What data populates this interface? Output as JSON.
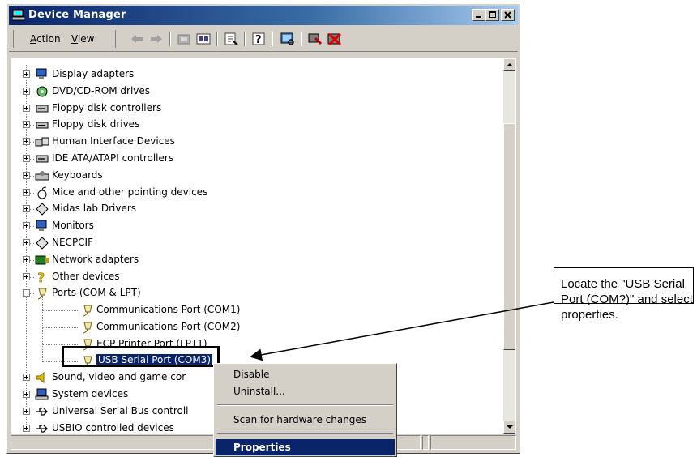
{
  "window": {
    "title": "Device Manager",
    "menu": [
      {
        "label_acc": "A",
        "label_rest": "ction"
      },
      {
        "label_acc": "V",
        "label_rest": "iew"
      }
    ]
  },
  "tree": {
    "items": [
      {
        "label": "Display adapters",
        "icon": "display-icon",
        "state": "collapsed"
      },
      {
        "label": "DVD/CD-ROM drives",
        "icon": "dvd-icon",
        "state": "collapsed"
      },
      {
        "label": "Floppy disk controllers",
        "icon": "disk-controller-icon",
        "state": "collapsed"
      },
      {
        "label": "Floppy disk drives",
        "icon": "floppy-drive-icon",
        "state": "collapsed"
      },
      {
        "label": "Human Interface Devices",
        "icon": "hid-icon",
        "state": "collapsed"
      },
      {
        "label": "IDE ATA/ATAPI controllers",
        "icon": "ide-icon",
        "state": "collapsed"
      },
      {
        "label": "Keyboards",
        "icon": "keyboard-icon",
        "state": "collapsed"
      },
      {
        "label": "Mice and other pointing devices",
        "icon": "mouse-icon",
        "state": "collapsed"
      },
      {
        "label": "Midas lab Drivers",
        "icon": "device-icon",
        "state": "collapsed"
      },
      {
        "label": "Monitors",
        "icon": "monitor-icon",
        "state": "collapsed"
      },
      {
        "label": "NECPCIF",
        "icon": "device-icon",
        "state": "collapsed"
      },
      {
        "label": "Network adapters",
        "icon": "network-icon",
        "state": "collapsed"
      },
      {
        "label": "Other devices",
        "icon": "question-icon",
        "state": "collapsed"
      },
      {
        "label": "Ports (COM & LPT)",
        "icon": "port-icon",
        "state": "expanded"
      },
      {
        "label": "Sound, video and game cor",
        "icon": "sound-icon",
        "state": "collapsed"
      },
      {
        "label": "System devices",
        "icon": "computer-icon",
        "state": "collapsed"
      },
      {
        "label": "Universal Serial Bus controll",
        "icon": "usb-icon",
        "state": "collapsed"
      },
      {
        "label": "USBIO controlled devices",
        "icon": "usb-icon",
        "state": "collapsed"
      }
    ],
    "ports_children": [
      {
        "label": "Communications Port (COM1)",
        "icon": "port-icon"
      },
      {
        "label": "Communications Port (COM2)",
        "icon": "port-icon"
      },
      {
        "label": "ECP Printer Port (LPT1)",
        "icon": "port-icon"
      },
      {
        "label": "USB Serial Port (COM3)",
        "icon": "port-icon",
        "selected": true
      }
    ]
  },
  "context_menu": {
    "items": [
      {
        "label": "Disable"
      },
      {
        "label": "Uninstall..."
      },
      {
        "label": "Scan for hardware changes"
      },
      {
        "label": "Properties",
        "highlighted": true
      }
    ]
  },
  "callout": {
    "text": "Locate the \"USB Serial Port (COM?)\" and select properties."
  },
  "colors": {
    "selection": "#0a246a",
    "titlebar": "#0a246a",
    "face": "#d4d0c8"
  }
}
